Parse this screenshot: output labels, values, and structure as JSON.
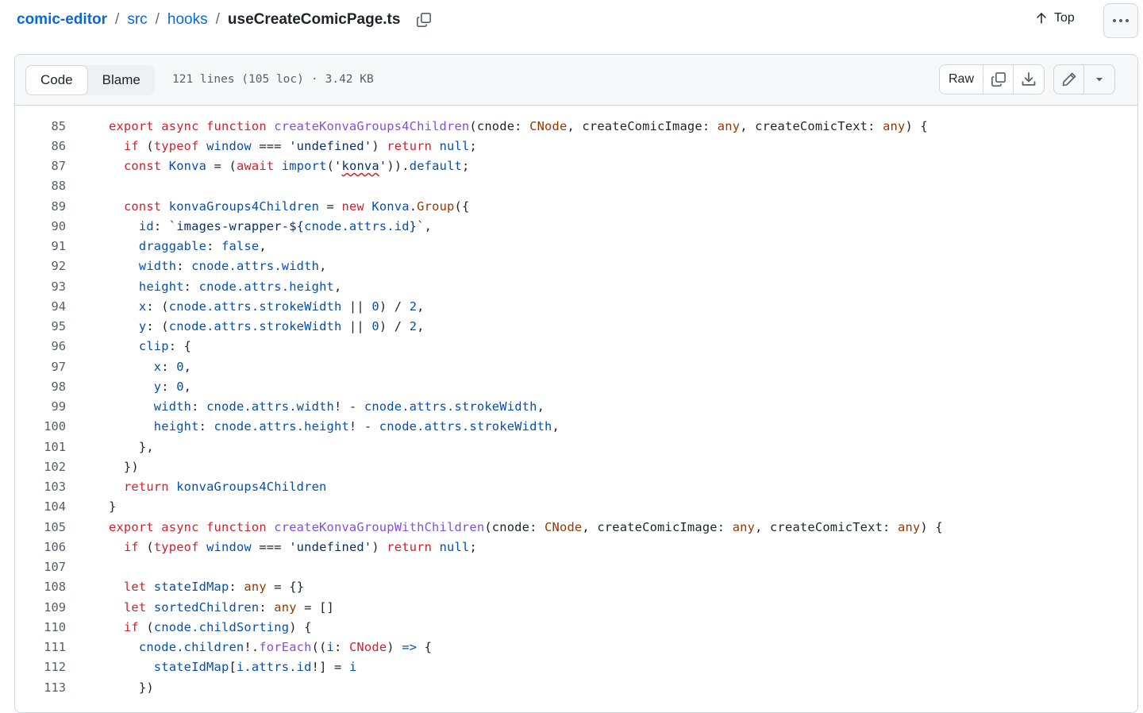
{
  "breadcrumb": {
    "repo": "comic-editor",
    "folder1": "src",
    "folder2": "hooks",
    "file": "useCreateComicPage.ts",
    "sep": "/"
  },
  "top_link": {
    "label": "Top"
  },
  "tabs": {
    "code": "Code",
    "blame": "Blame"
  },
  "file_meta": {
    "lines": "121 lines (105 loc)",
    "dot": "·",
    "size": "3.42 KB"
  },
  "actions": {
    "raw": "Raw"
  },
  "colors": {
    "keyword": "#cf222e",
    "function": "#8250df",
    "variable": "#0550ae",
    "string": "#0a3069",
    "link": "#0969da"
  },
  "code_lines": [
    {
      "n": "85"
    },
    {
      "n": "86"
    },
    {
      "n": "87"
    },
    {
      "n": "88"
    },
    {
      "n": "89"
    },
    {
      "n": "90"
    },
    {
      "n": "91"
    },
    {
      "n": "92"
    },
    {
      "n": "93"
    },
    {
      "n": "94"
    },
    {
      "n": "95"
    },
    {
      "n": "96"
    },
    {
      "n": "97"
    },
    {
      "n": "98"
    },
    {
      "n": "99"
    },
    {
      "n": "100"
    },
    {
      "n": "101"
    },
    {
      "n": "102"
    },
    {
      "n": "103"
    },
    {
      "n": "104"
    },
    {
      "n": "105"
    },
    {
      "n": "106"
    },
    {
      "n": "107"
    },
    {
      "n": "108"
    },
    {
      "n": "109"
    },
    {
      "n": "110"
    },
    {
      "n": "111"
    },
    {
      "n": "112"
    },
    {
      "n": "113"
    }
  ],
  "code_text": {
    "l85": "export async function createKonvaGroups4Children(cnode: CNode, createComicImage: any, createComicText: any) {",
    "l86": "  if (typeof window === 'undefined') return null;",
    "l87": "  const Konva = (await import('konva')).default;",
    "l88": "",
    "l89": "  const konvaGroups4Children = new Konva.Group({",
    "l90": "    id: `images-wrapper-${cnode.attrs.id}`,",
    "l91": "    draggable: false,",
    "l92": "    width: cnode.attrs.width,",
    "l93": "    height: cnode.attrs.height,",
    "l94": "    x: (cnode.attrs.strokeWidth || 0) / 2,",
    "l95": "    y: (cnode.attrs.strokeWidth || 0) / 2,",
    "l96": "    clip: {",
    "l97": "      x: 0,",
    "l98": "      y: 0,",
    "l99": "      width: cnode.attrs.width! - cnode.attrs.strokeWidth,",
    "l100": "      height: cnode.attrs.height! - cnode.attrs.strokeWidth,",
    "l101": "    },",
    "l102": "  })",
    "l103": "  return konvaGroups4Children",
    "l104": "}",
    "l105": "export async function createKonvaGroupWithChildren(cnode: CNode, createComicImage: any, createComicText: any) {",
    "l106": "  if (typeof window === 'undefined') return null;",
    "l107": "",
    "l108": "  let stateIdMap: any = {}",
    "l109": "  let sortedChildren: any = []",
    "l110": "  if (cnode.childSorting) {",
    "l111": "    cnode.children!.forEach((i: CNode) => {",
    "l112": "      stateIdMap[i.attrs.id!] = i",
    "l113": "    })"
  }
}
